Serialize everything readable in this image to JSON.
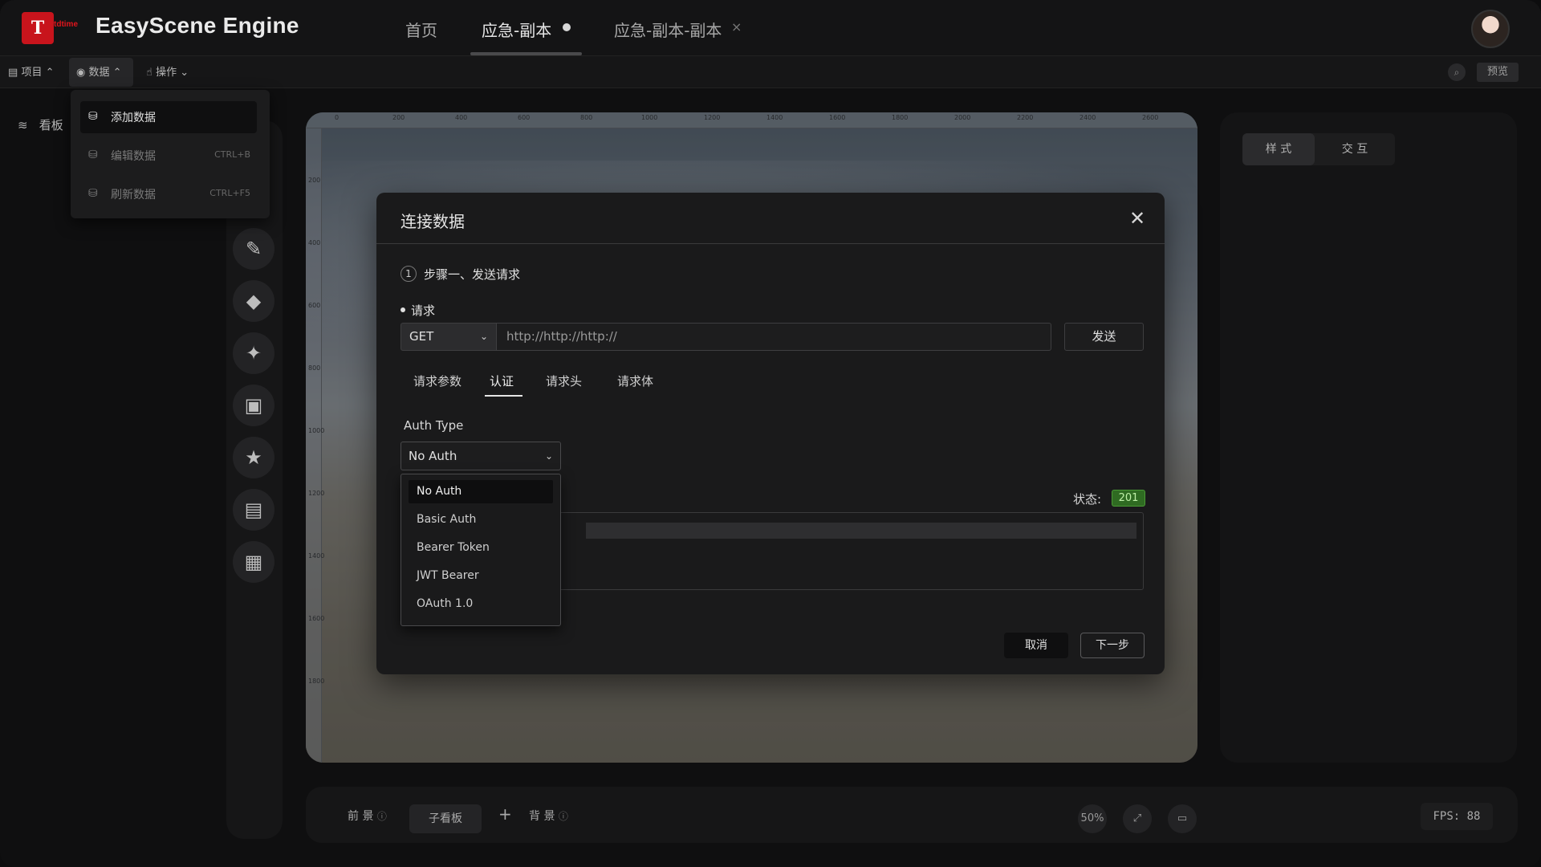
{
  "app": {
    "logo_letter": "T",
    "logo_text": "tdtime",
    "title": "EasyScene Engine"
  },
  "tabs": [
    {
      "label": "首页"
    },
    {
      "label": "应急-副本"
    },
    {
      "label": "应急-副本-副本"
    }
  ],
  "tab_close": "×",
  "toolbar": {
    "items": [
      {
        "icon": "file-icon",
        "label": "项目",
        "chevron": "⌃"
      },
      {
        "icon": "database-icon",
        "label": "数据",
        "chevron": "⌃"
      },
      {
        "icon": "cursor-icon",
        "label": "操作",
        "chevron": "⌄"
      }
    ],
    "preview_label": "预览"
  },
  "data_menu": [
    {
      "icon": "database-add-icon",
      "label": "添加数据",
      "shortcut": ""
    },
    {
      "icon": "database-edit-icon",
      "label": "编辑数据",
      "shortcut": "CTRL+B"
    },
    {
      "icon": "database-refresh-icon",
      "label": "刷新数据",
      "shortcut": "CTRL+F5"
    }
  ],
  "left_panel": {
    "item_label": "看板"
  },
  "rail_icons": [
    "brush-icon",
    "gem-icon",
    "magic-wand-icon",
    "layers-icon",
    "star-icon",
    "document-icon",
    "grid-icon"
  ],
  "ruler": {
    "top": [
      "0",
      "200",
      "400",
      "600",
      "800",
      "1000",
      "1200",
      "1400",
      "1600",
      "1800",
      "2000",
      "2200",
      "2400",
      "2600"
    ],
    "left": [
      "200",
      "400",
      "600",
      "800",
      "1000",
      "1200",
      "1400",
      "1600",
      "1800"
    ]
  },
  "right_panel": {
    "tabs": [
      "样 式",
      "交 互"
    ]
  },
  "bottom_bar": {
    "foreground": "前 景",
    "sub_board": "子看板",
    "add": "+",
    "background": "背 景",
    "zoom": "50%",
    "fps": "FPS: 88"
  },
  "dialog": {
    "title": "连接数据",
    "close": "✕",
    "step_number": "1",
    "step_label": "步骤一、发送请求",
    "request_label": "请求",
    "method": "GET",
    "url_placeholder": "http://http://http://",
    "send_label": "发送",
    "tabs": [
      "请求参数",
      "认证",
      "请求头",
      "请求体"
    ],
    "auth_type_label": "Auth Type",
    "auth_selected": "No Auth",
    "auth_options": [
      "No Auth",
      "Basic Auth",
      "Bearer Token",
      "JWT Bearer",
      "OAuth 1.0"
    ],
    "status_label": "状态:",
    "status_code": "201",
    "cancel_label": "取消",
    "next_label": "下一步"
  },
  "colors": {
    "accent_red": "#c8141c",
    "status_green": "#2f6b22"
  }
}
